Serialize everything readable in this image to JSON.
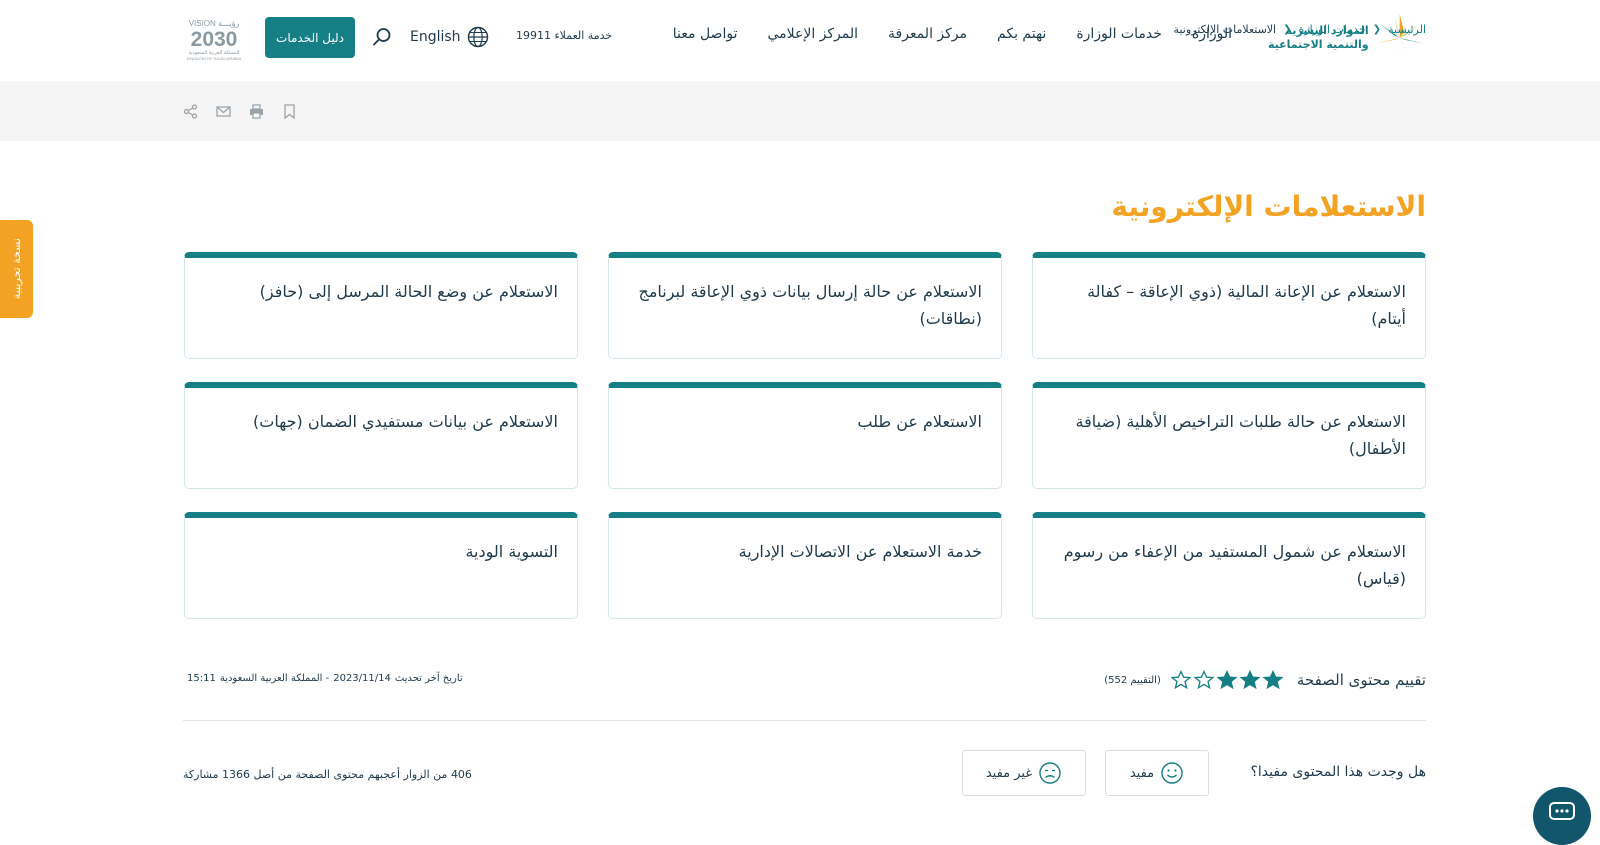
{
  "header": {
    "logo_line1": "الموارد البشرية",
    "logo_line2": "والتنمية الاجتماعية",
    "nav": [
      {
        "label": "الوزارة"
      },
      {
        "label": "خدمات الوزارة"
      },
      {
        "label": "نهتم بكم"
      },
      {
        "label": "مركز المعرفة"
      },
      {
        "label": "المركز الإعلامي"
      },
      {
        "label": "تواصل معنا"
      }
    ],
    "customer_service": "خدمة العملاء 19911",
    "language": "English",
    "services_guide": "دليل الخدمات",
    "vision_top": "VISION رؤيـــة",
    "vision_year": "2030",
    "vision_sub1": "المملكة العربية السعودية",
    "vision_sub2": "KINGDOM OF SAUDI ARABIA"
  },
  "breadcrumb": [
    {
      "label": "الرئيسية"
    },
    {
      "label": "خدمات الوزارة"
    },
    {
      "label": "الاستعلامات الإلكترونية"
    }
  ],
  "sandbox_label": "نسخة تجريبية",
  "page_title": "الاستعلامات الإلكترونية",
  "cards": [
    {
      "title": "الاستعلام عن الإعانة المالية (ذوي الإعاقة – كفالة أيتام)"
    },
    {
      "title": "الاستعلام عن حالة إرسال بيانات ذوي الإعاقة لبرنامج (نطاقات)"
    },
    {
      "title": "الاستعلام عن وضع الحالة المرسل إلى (حافز)"
    },
    {
      "title": "الاستعلام عن حالة طلبات التراخيص الأهلية (ضيافة الأطفال)"
    },
    {
      "title": "الاستعلام عن طلب"
    },
    {
      "title": "الاستعلام عن بيانات مستفيدي الضمان (جهات)"
    },
    {
      "title": "الاستعلام عن شمول المستفيد من الإعفاء من رسوم (قياس)"
    },
    {
      "title": "خدمة الاستعلام عن الاتصالات الإدارية"
    },
    {
      "title": "التسوية الودية"
    }
  ],
  "rating": {
    "label": "تقييم محتوى الصفحة",
    "value": 3,
    "max": 5,
    "count_text": "(التقييم 552)"
  },
  "last_update": {
    "label": "تاريخ آخر تحديث",
    "date": "2023/11/14",
    "location": "- المملكة العربية السعودية",
    "time": "15:11"
  },
  "feedback": {
    "question": "هل وجدت هذا المحتوى مفيدا؟",
    "useful": "مفيد",
    "not_useful": "غير مفيد",
    "stats": "406 من الزوار أعجبهم محتوى الصفحة من أصل 1366 مشاركة"
  },
  "colors": {
    "primary": "#157f85",
    "accent": "#f4a223",
    "text": "#1e3a4c",
    "chat": "#11566b"
  }
}
